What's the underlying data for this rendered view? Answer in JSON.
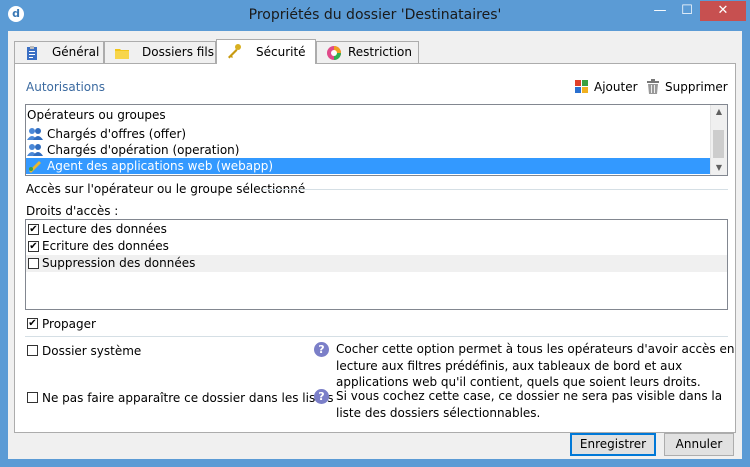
{
  "window": {
    "title": "Propriétés du dossier 'Destinataires'",
    "app_icon": "d"
  },
  "title_controls": {
    "minimize": "—",
    "maximize": "☐",
    "close": "✕"
  },
  "tabs": [
    {
      "label": "Général",
      "icon": "clipboard-icon",
      "active": false
    },
    {
      "label": "Dossiers fils",
      "icon": "folder-icon",
      "active": false
    },
    {
      "label": "Sécurité",
      "icon": "key-icon",
      "active": true
    },
    {
      "label": "Restriction",
      "icon": "restriction-icon",
      "active": false
    }
  ],
  "authorizations": {
    "label": "Autorisations",
    "add_label": "Ajouter",
    "add_icon": "add-user-icon",
    "remove_label": "Supprimer",
    "remove_icon": "trash-icon",
    "list_header": "Opérateurs ou groupes",
    "items": [
      {
        "label": "Chargés d'offres (offer)",
        "icon": "group-icon",
        "selected": false
      },
      {
        "label": "Chargés d'opération (operation)",
        "icon": "group-icon",
        "selected": false
      },
      {
        "label": "Agent des applications web (webapp)",
        "icon": "agent-icon",
        "selected": true
      }
    ]
  },
  "access": {
    "section_label": "Accès sur l'opérateur ou le groupe sélectionné",
    "rights_label": "Droits d'accès :",
    "rights": [
      {
        "label": "Lecture des données",
        "checked": true
      },
      {
        "label": "Ecriture des données",
        "checked": true
      },
      {
        "label": "Suppression des données",
        "checked": false
      }
    ],
    "propagate": {
      "label": "Propager",
      "checked": true
    }
  },
  "options": {
    "system_folder": {
      "label": "Dossier système",
      "checked": false,
      "help": "Cocher cette option permet à tous les opérateurs d'avoir accès en lecture aux filtres prédéfinis, aux tableaux de bord et aux applications web qu'il contient, quels que soient leurs droits."
    },
    "hide_folder": {
      "label": "Ne pas faire apparaître ce dossier dans les listes",
      "checked": false,
      "help": "Si vous cochez cette case, ce dossier ne sera pas visible dans la liste des dossiers sélectionnables."
    }
  },
  "buttons": {
    "save": "Enregistrer",
    "cancel": "Annuler"
  },
  "colors": {
    "title_bar": "#5b9bd5",
    "selection": "#3399ff",
    "close_button": "#c75050",
    "section_label": "#3b6aa0"
  }
}
